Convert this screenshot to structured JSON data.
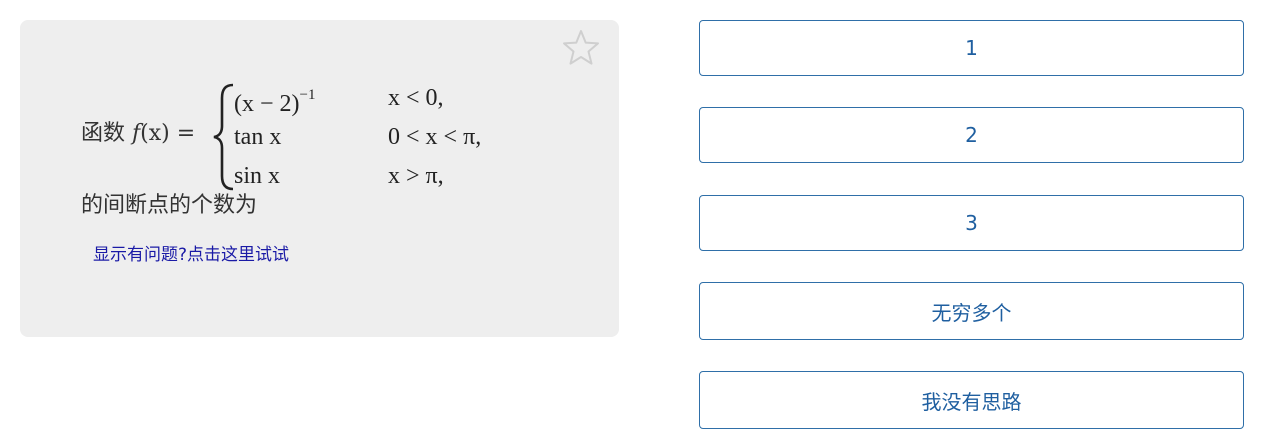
{
  "question": {
    "prefix_text": "函数",
    "function_name": "f",
    "function_arg": "(x) =",
    "cases": [
      {
        "expr_base": "(x − 2)",
        "expr_sup": "−1",
        "condition": "x < 0,"
      },
      {
        "expr_base": "tan x",
        "expr_sup": "",
        "condition": "0 < x < π,"
      },
      {
        "expr_base": "sin x",
        "expr_sup": "",
        "condition": "x > π,"
      }
    ],
    "suffix_text": "的间断点的个数为",
    "display_issue_link": "显示有问题?点击这里试试"
  },
  "options": [
    {
      "label": "1"
    },
    {
      "label": "2"
    },
    {
      "label": "3"
    },
    {
      "label": "无穷多个"
    },
    {
      "label": "我没有思路"
    }
  ],
  "colors": {
    "card_background": "#eeeeee",
    "option_border": "#2f6fa8",
    "option_text": "#1f5fa0",
    "link_text": "#1a1aa6",
    "star_outline": "#cfcfcf"
  },
  "icons": {
    "favorite": "star-outline-icon"
  }
}
